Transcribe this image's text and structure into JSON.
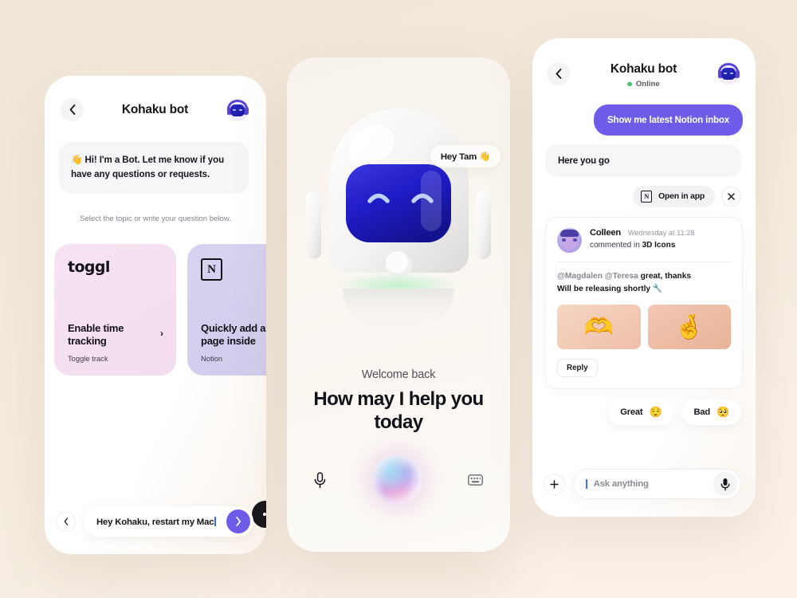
{
  "theme": {
    "accent": "#6E5CE8",
    "bg": "#F2E8DA",
    "dark": "#17161B",
    "online_green": "#3EC76A"
  },
  "phone_left": {
    "back_icon": "chevron-left-icon",
    "title": "Kohaku bot",
    "avatar_icon": "bot-avatar-icon",
    "bot_message": "👋 Hi! I'm a Bot. Let me know if you have any questions or requests.",
    "topic_hint": "Select the topic or write your question below.",
    "cards": [
      {
        "brand": "toggl",
        "brand_icon": "toggl-logo",
        "title": "Enable time tracking",
        "sub": "Toggle track",
        "arrow": "›"
      },
      {
        "brand": "Notion",
        "brand_icon": "notion-logo",
        "title": "Quickly add a page inside",
        "sub": "Notion",
        "arrow": "›"
      },
      {
        "brand": "",
        "brand_icon": "app-logo",
        "title": "",
        "sub": "",
        "arrow": ""
      }
    ],
    "typing_indicator": "typing-dots",
    "back_mini_icon": "chevron-left-icon",
    "input_value": "Hey Kohaku, restart my Mac",
    "send_icon": "chevron-right-icon"
  },
  "phone_mid": {
    "robot_icon": "3d-robot-mascot",
    "speech_bubble": "Hey Tam 👋",
    "welcome_small": "Welcome back",
    "welcome_large": "How may I help you today",
    "mic_icon": "microphone-icon",
    "orb_icon": "voice-orb-icon",
    "keyboard_icon": "keyboard-icon"
  },
  "phone_right": {
    "back_icon": "chevron-left-icon",
    "title": "Kohaku bot",
    "status": "Online",
    "avatar_icon": "bot-avatar-icon",
    "user_message": "Show me latest Notion inbox",
    "bot_message": "Here you go",
    "open_in_app": "Open in app",
    "open_in_app_icon": "notion-logo",
    "close_icon": "close-icon",
    "notification": {
      "avatar_icon": "user-avatar-colleen",
      "name": "Colleen",
      "time": "Wednesday at 11:28",
      "action_prefix": "commented in ",
      "action_target": "3D Icons",
      "mentions": "@Magdalen @Teresa",
      "body_text": "great, thanks",
      "body_line2": "Will be releasing shortly 🔧",
      "images": [
        {
          "icon": "3d-hands-heart",
          "emoji": "🫶"
        },
        {
          "icon": "3d-hand-finger-heart",
          "emoji": "🤞"
        }
      ],
      "reply_label": "Reply"
    },
    "reactions": [
      {
        "label": "Great",
        "emoji": "😌"
      },
      {
        "label": "Bad",
        "emoji": "🥺"
      }
    ],
    "plus_icon": "plus-icon",
    "input_placeholder": "Ask anything",
    "mic_icon": "microphone-icon"
  }
}
